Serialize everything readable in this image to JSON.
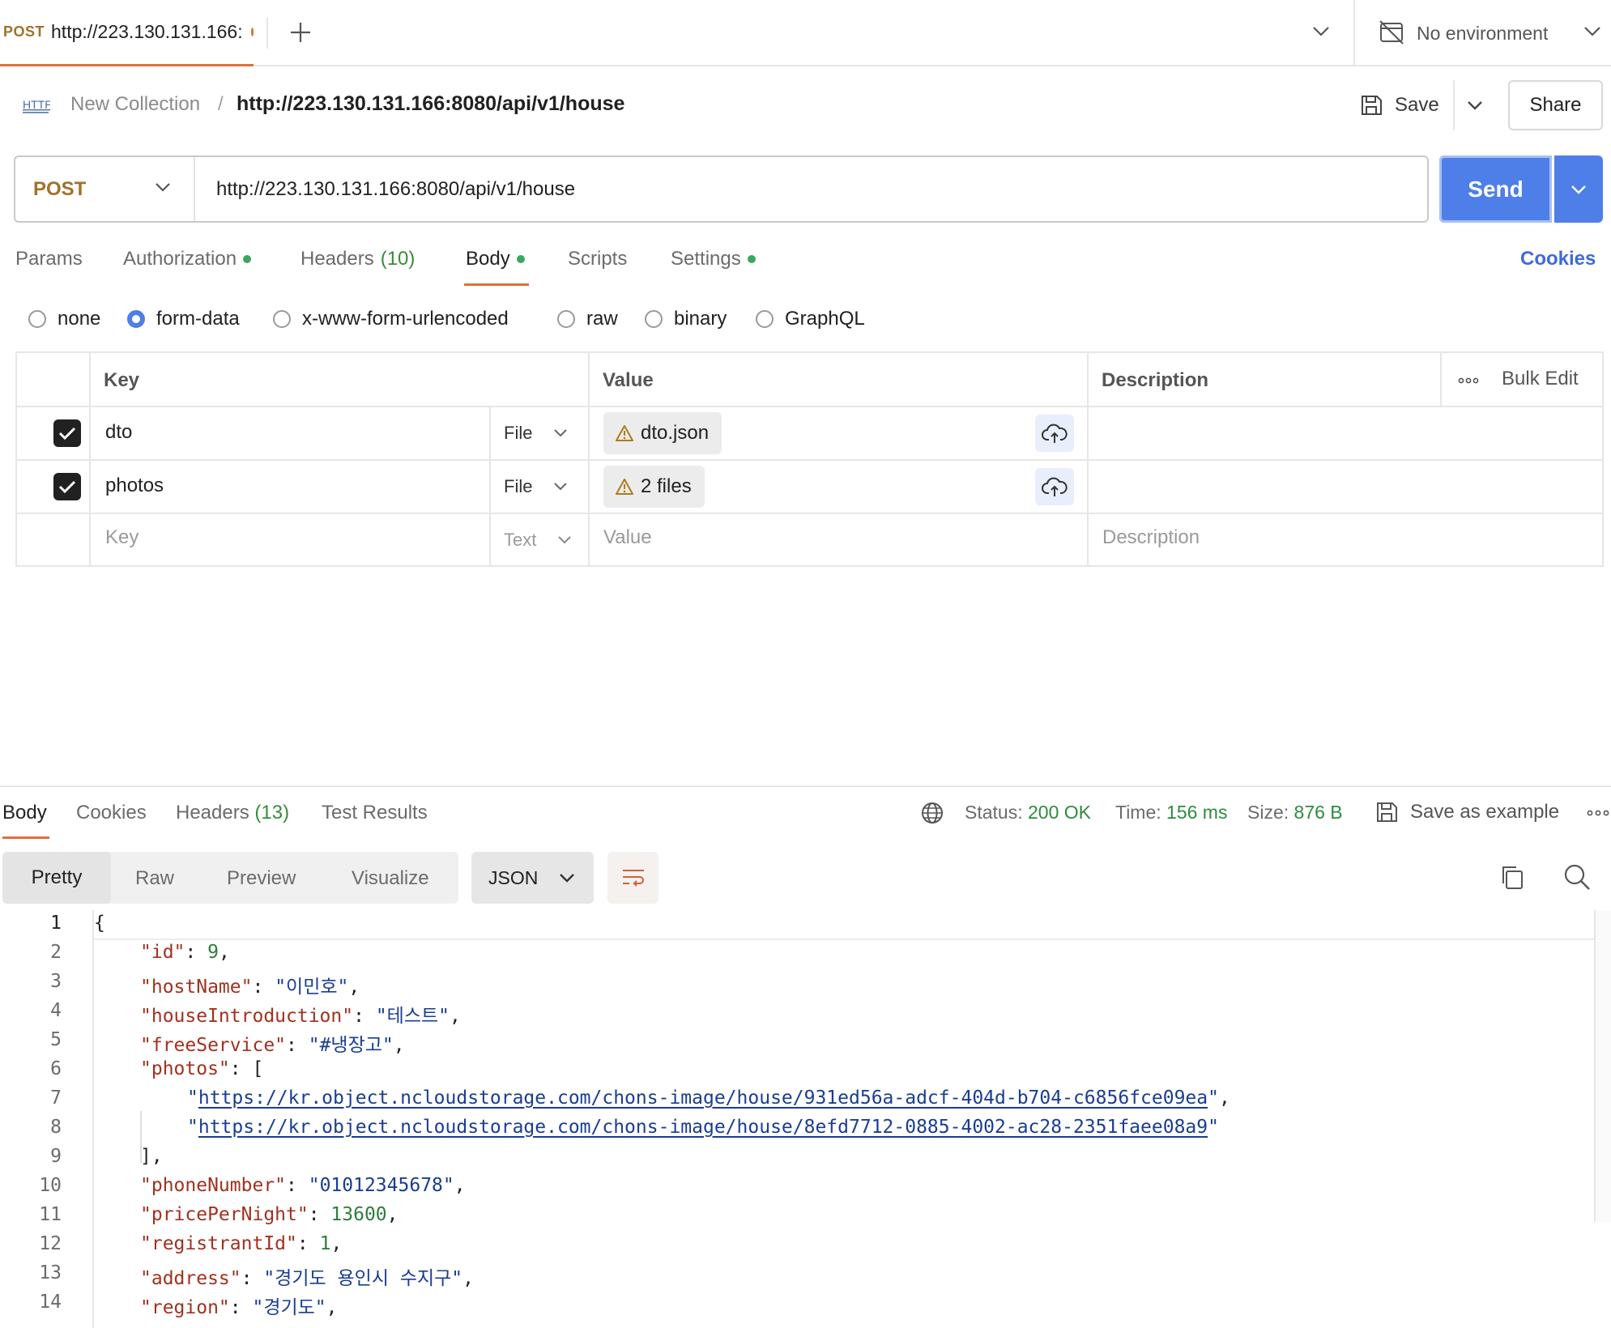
{
  "top_tab": {
    "method": "POST",
    "title": "http://223.130.131.166:"
  },
  "environment": {
    "label": "No environment"
  },
  "breadcrumb": {
    "collection": "New Collection",
    "separator": "/",
    "current": "http://223.130.131.166:8080/api/v1/house"
  },
  "actions": {
    "save": "Save",
    "share": "Share"
  },
  "request": {
    "method": "POST",
    "url": "http://223.130.131.166:8080/api/v1/house",
    "send": "Send"
  },
  "request_tabs": {
    "params": "Params",
    "authorization": "Authorization",
    "headers": "Headers",
    "headers_count": "(10)",
    "body": "Body",
    "scripts": "Scripts",
    "settings": "Settings",
    "cookies": "Cookies"
  },
  "body_types": [
    "none",
    "form-data",
    "x-www-form-urlencoded",
    "raw",
    "binary",
    "GraphQL"
  ],
  "selected_body_type": "form-data",
  "form_table": {
    "headers": {
      "key": "Key",
      "value": "Value",
      "description": "Description",
      "bulk_edit": "Bulk Edit"
    },
    "rows": [
      {
        "key": "dto",
        "type": "File",
        "value": "dto.json"
      },
      {
        "key": "photos",
        "type": "File",
        "value": "2 files"
      }
    ],
    "placeholder": {
      "key": "Key",
      "type": "Text",
      "value": "Value",
      "description": "Description"
    }
  },
  "response_tabs": {
    "body": "Body",
    "cookies": "Cookies",
    "headers": "Headers",
    "headers_count": "(13)",
    "test_results": "Test Results"
  },
  "response_meta": {
    "status_label": "Status:",
    "status_value": "200 OK",
    "time_label": "Time:",
    "time_value": "156 ms",
    "size_label": "Size:",
    "size_value": "876 B",
    "save_example": "Save as example"
  },
  "view_options": {
    "pretty": "Pretty",
    "raw": "Raw",
    "preview": "Preview",
    "visualize": "Visualize",
    "format": "JSON"
  },
  "code": {
    "line_numbers": [
      "1",
      "2",
      "3",
      "4",
      "5",
      "6",
      "7",
      "8",
      "9",
      "10",
      "11",
      "12",
      "13",
      "14"
    ],
    "open_brace": "{",
    "id_key": "\"id\"",
    "id_val": "9",
    "hostName_key": "\"hostName\"",
    "hostName_val": "\"이민호\"",
    "houseIntroduction_key": "\"houseIntroduction\"",
    "houseIntroduction_val": "\"테스트\"",
    "freeService_key": "\"freeService\"",
    "freeService_val": "\"#냉장고\"",
    "photos_key": "\"photos\"",
    "photo_1": "https://kr.object.ncloudstorage.com/chons-image/house/931ed56a-adcf-404d-b704-c6856fce09ea",
    "photo_2": "https://kr.object.ncloudstorage.com/chons-image/house/8efd7712-0885-4002-ac28-2351faee08a9",
    "phoneNumber_key": "\"phoneNumber\"",
    "phoneNumber_val": "\"01012345678\"",
    "pricePerNight_key": "\"pricePerNight\"",
    "pricePerNight_val": "13600",
    "registrantId_key": "\"registrantId\"",
    "registrantId_val": "1",
    "address_key": "\"address\"",
    "address_val": "\"경기도 용인시 수지구\"",
    "region_key": "\"region\"",
    "region_val": "\"경기도\""
  },
  "colors": {
    "accent": "#e0703a",
    "send": "#4e7fe8",
    "method": "#a2702a",
    "status_ok": "#2e8b3e",
    "link": "#3f6ad8"
  }
}
